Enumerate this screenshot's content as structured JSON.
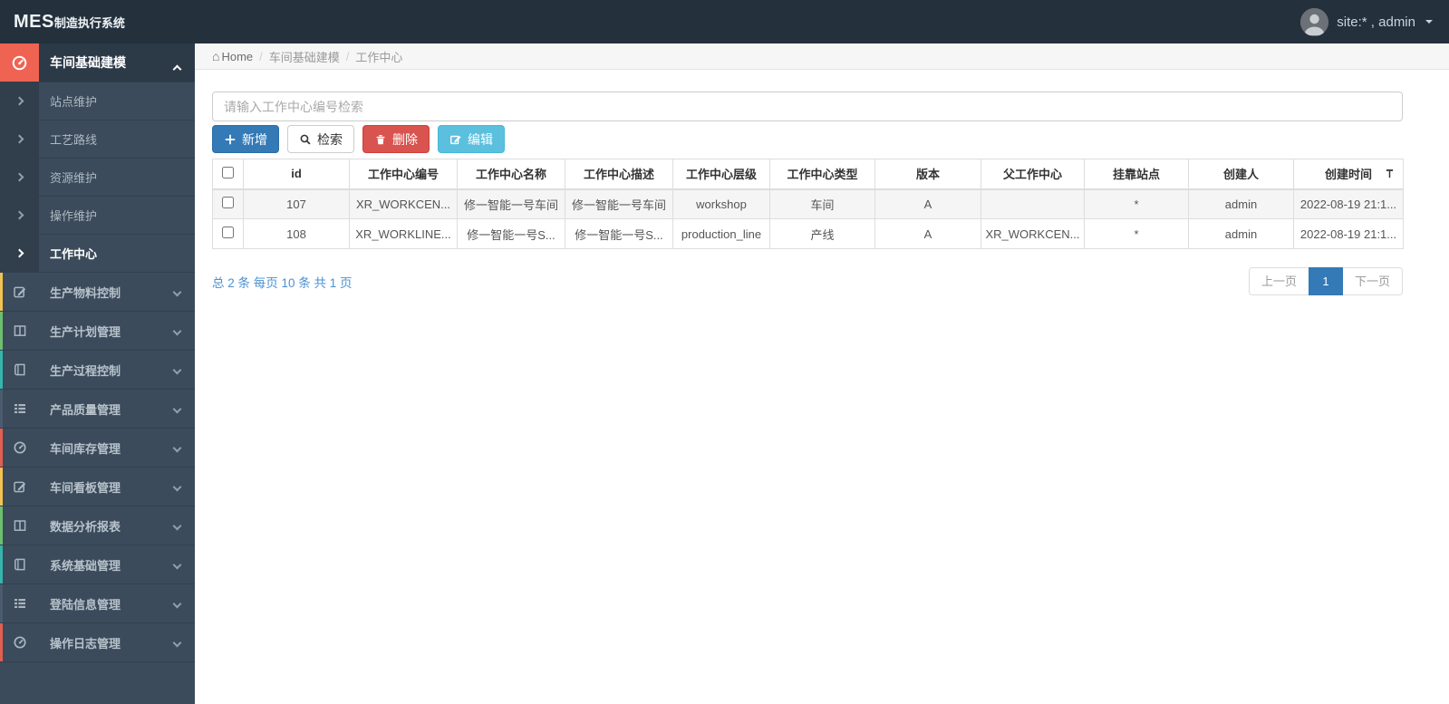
{
  "topbar": {
    "logo_bold": "MES",
    "logo_rest": "制造执行系统",
    "user_label": "site:* , admin"
  },
  "sidebar": {
    "parent": {
      "label": "车间基础建模",
      "icon": "gauge",
      "accent": "#ef6352",
      "children": [
        {
          "label": "站点维护",
          "active": false
        },
        {
          "label": "工艺路线",
          "active": false
        },
        {
          "label": "资源维护",
          "active": false
        },
        {
          "label": "操作维护",
          "active": false
        },
        {
          "label": "工作中心",
          "active": true
        }
      ]
    },
    "items": [
      {
        "label": "生产物料控制",
        "icon": "edit",
        "stripe": "#f3c252"
      },
      {
        "label": "生产计划管理",
        "icon": "columns",
        "stripe": "#6dbf6d"
      },
      {
        "label": "生产过程控制",
        "icon": "book",
        "stripe": "#35b5ac"
      },
      {
        "label": "产品质量管理",
        "icon": "list",
        "stripe": "#4a5c6e"
      },
      {
        "label": "车间库存管理",
        "icon": "gauge",
        "stripe": "#e25d52"
      },
      {
        "label": "车间看板管理",
        "icon": "edit",
        "stripe": "#f3c252"
      },
      {
        "label": "数据分析报表",
        "icon": "columns",
        "stripe": "#6dbf6d"
      },
      {
        "label": "系统基础管理",
        "icon": "book",
        "stripe": "#35b5ac"
      },
      {
        "label": "登陆信息管理",
        "icon": "list",
        "stripe": "#4a5c6e"
      },
      {
        "label": "操作日志管理",
        "icon": "gauge",
        "stripe": "#e25d52"
      }
    ]
  },
  "breadcrumb": {
    "home": "Home",
    "crumbs": [
      "车间基础建模",
      "工作中心"
    ]
  },
  "toolbar": {
    "search_placeholder": "请输入工作中心编号检索",
    "add_label": "新增",
    "search_label": "检索",
    "delete_label": "删除",
    "edit_label": "编辑"
  },
  "table": {
    "headers": [
      "id",
      "工作中心编号",
      "工作中心名称",
      "工作中心描述",
      "工作中心层级",
      "工作中心类型",
      "版本",
      "父工作中心",
      "挂靠站点",
      "创建人",
      "创建时间"
    ],
    "rows": [
      [
        "107",
        "XR_WORKCEN...",
        "修一智能一号车间",
        "修一智能一号车间",
        "workshop",
        "车间",
        "A",
        "",
        "*",
        "admin",
        "2022-08-19 21:1..."
      ],
      [
        "108",
        "XR_WORKLINE...",
        "修一智能一号S...",
        "修一智能一号S...",
        "production_line",
        "产线",
        "A",
        "XR_WORKCEN...",
        "*",
        "admin",
        "2022-08-19 21:1..."
      ]
    ]
  },
  "pagination": {
    "summary": "总 2 条  每页 10 条  共 1 页",
    "prev": "上一页",
    "current": "1",
    "next": "下一页"
  },
  "colors": {
    "primary": "#337ab7",
    "danger": "#d9534f",
    "info": "#5bc0de",
    "accent_red": "#ef6352"
  }
}
